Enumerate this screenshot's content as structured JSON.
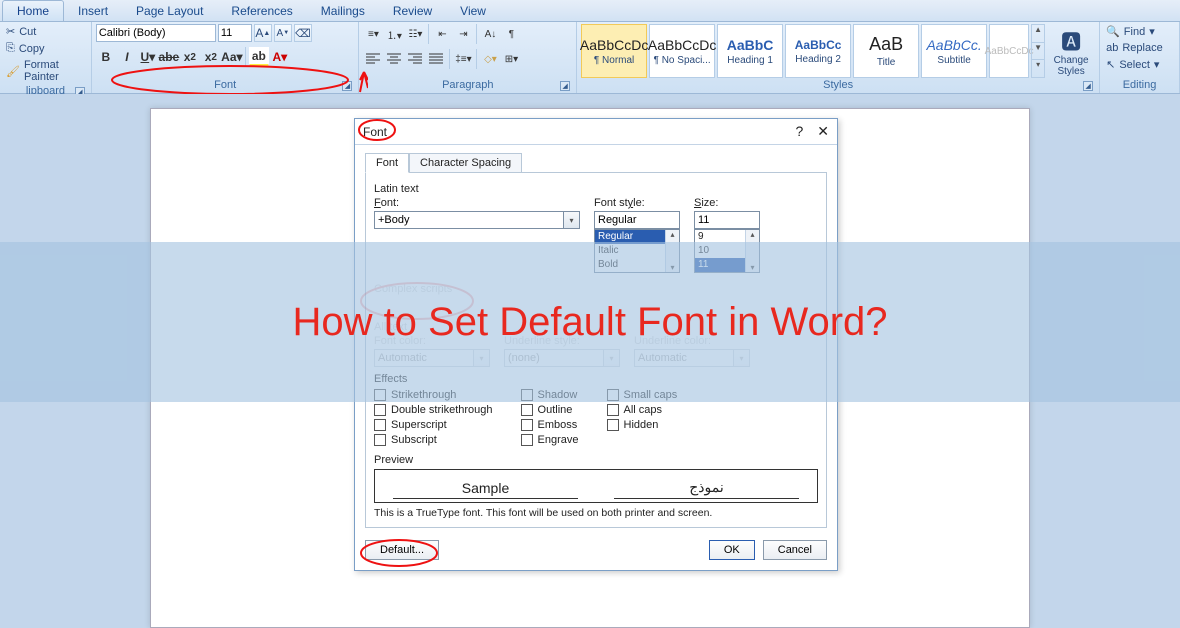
{
  "tabs": {
    "home": "Home",
    "insert": "Insert",
    "page_layout": "Page Layout",
    "references": "References",
    "mailings": "Mailings",
    "review": "Review",
    "view": "View"
  },
  "clipboard": {
    "cut": "Cut",
    "copy": "Copy",
    "fmt_painter": "Format Painter",
    "title": "lipboard"
  },
  "font_group": {
    "font_name": "Calibri (Body)",
    "font_size": "11",
    "title": "Font"
  },
  "paragraph_group": {
    "title": "Paragraph"
  },
  "styles": {
    "items": [
      {
        "preview": "AaBbCcDc",
        "label": "¶ Normal"
      },
      {
        "preview": "AaBbCcDc",
        "label": "¶ No Spaci..."
      },
      {
        "preview": "AaBbC",
        "label": "Heading 1"
      },
      {
        "preview": "AaBbCc",
        "label": "Heading 2"
      },
      {
        "preview": "AaB",
        "label": "Title"
      },
      {
        "preview": "AaBbCc.",
        "label": "Subtitle"
      },
      {
        "preview": "AaBbCcDc",
        "label": ""
      }
    ],
    "change": "Change Styles",
    "title": "Styles"
  },
  "editing": {
    "find": "Find",
    "replace": "Replace",
    "select": "Select",
    "title": "Editing"
  },
  "dialog": {
    "title": "Font",
    "tab_font": "Font",
    "tab_char": "Character Spacing",
    "latin_text": "Latin text",
    "font_lbl": "Font:",
    "font_val": "+Body",
    "style_lbl": "Font style:",
    "style_val": "Regular",
    "style_opts": [
      "Regular",
      "Italic",
      "Bold"
    ],
    "size_lbl": "Size:",
    "size_val": "11",
    "size_opts": [
      "9",
      "10",
      "11"
    ],
    "complex": "Complex scripts",
    "all_text": "All text",
    "fcolor_lbl": "Font color:",
    "fcolor_val": "Automatic",
    "ustyle_lbl": "Underline style:",
    "ustyle_val": "(none)",
    "ucolor_lbl": "Underline color:",
    "ucolor_val": "Automatic",
    "effects": "Effects",
    "fx": {
      "strike": "Strikethrough",
      "dstrike": "Double strikethrough",
      "super": "Superscript",
      "sub": "Subscript",
      "shadow": "Shadow",
      "outline": "Outline",
      "emboss": "Emboss",
      "engrave": "Engrave",
      "scaps": "Small caps",
      "acaps": "All caps",
      "hidden": "Hidden"
    },
    "preview": "Preview",
    "sample1": "Sample",
    "sample2": "نموذج",
    "note": "This is a TrueType font. This font will be used on both printer and screen.",
    "default_btn": "Default...",
    "ok": "OK",
    "cancel": "Cancel"
  },
  "overlay_text": "How to Set Default Font in Word?"
}
